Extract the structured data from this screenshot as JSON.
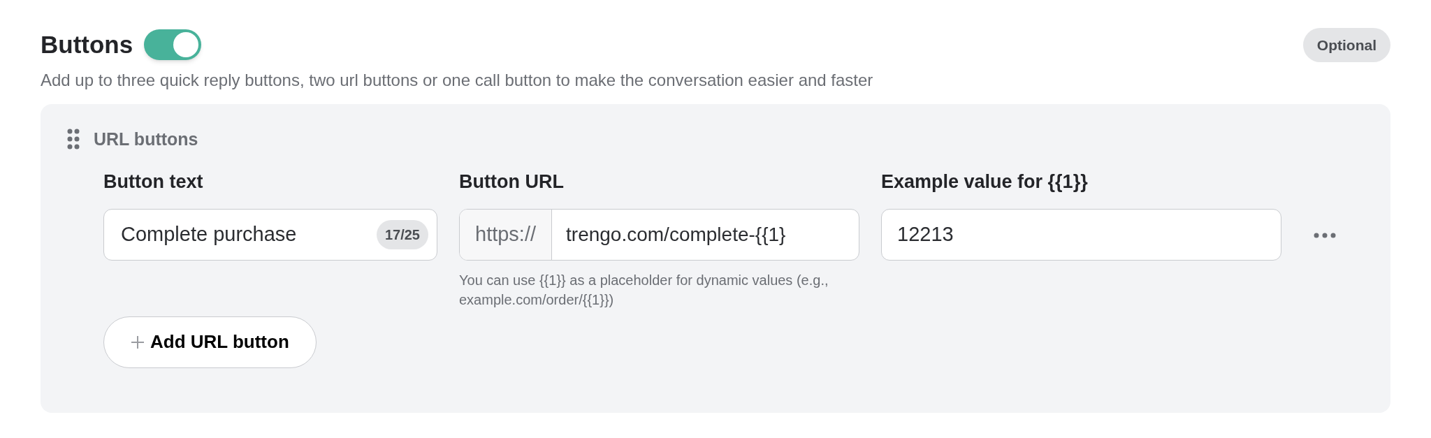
{
  "section": {
    "title": "Buttons",
    "toggle": {
      "on": true
    },
    "badge": "Optional",
    "description": "Add up to three quick reply buttons, two url buttons or one call button to make the conversation easier and faster"
  },
  "group": {
    "title": "URL buttons",
    "fields": [
      {
        "kind": "counter",
        "label": "Button text",
        "value": "Complete purchase",
        "counter": "17/25"
      },
      {
        "kind": "prefixed",
        "label": "Button URL",
        "prefix": "https://",
        "value": "trengo.com/complete-{{1}",
        "helper": "You can use {{1}} as a placeholder for dynamic values (e.g., example.com/order/{{1}})"
      },
      {
        "kind": "plain",
        "label": "Example value for {{1}}",
        "value": "12213"
      }
    ],
    "add_button": "Add URL button"
  }
}
